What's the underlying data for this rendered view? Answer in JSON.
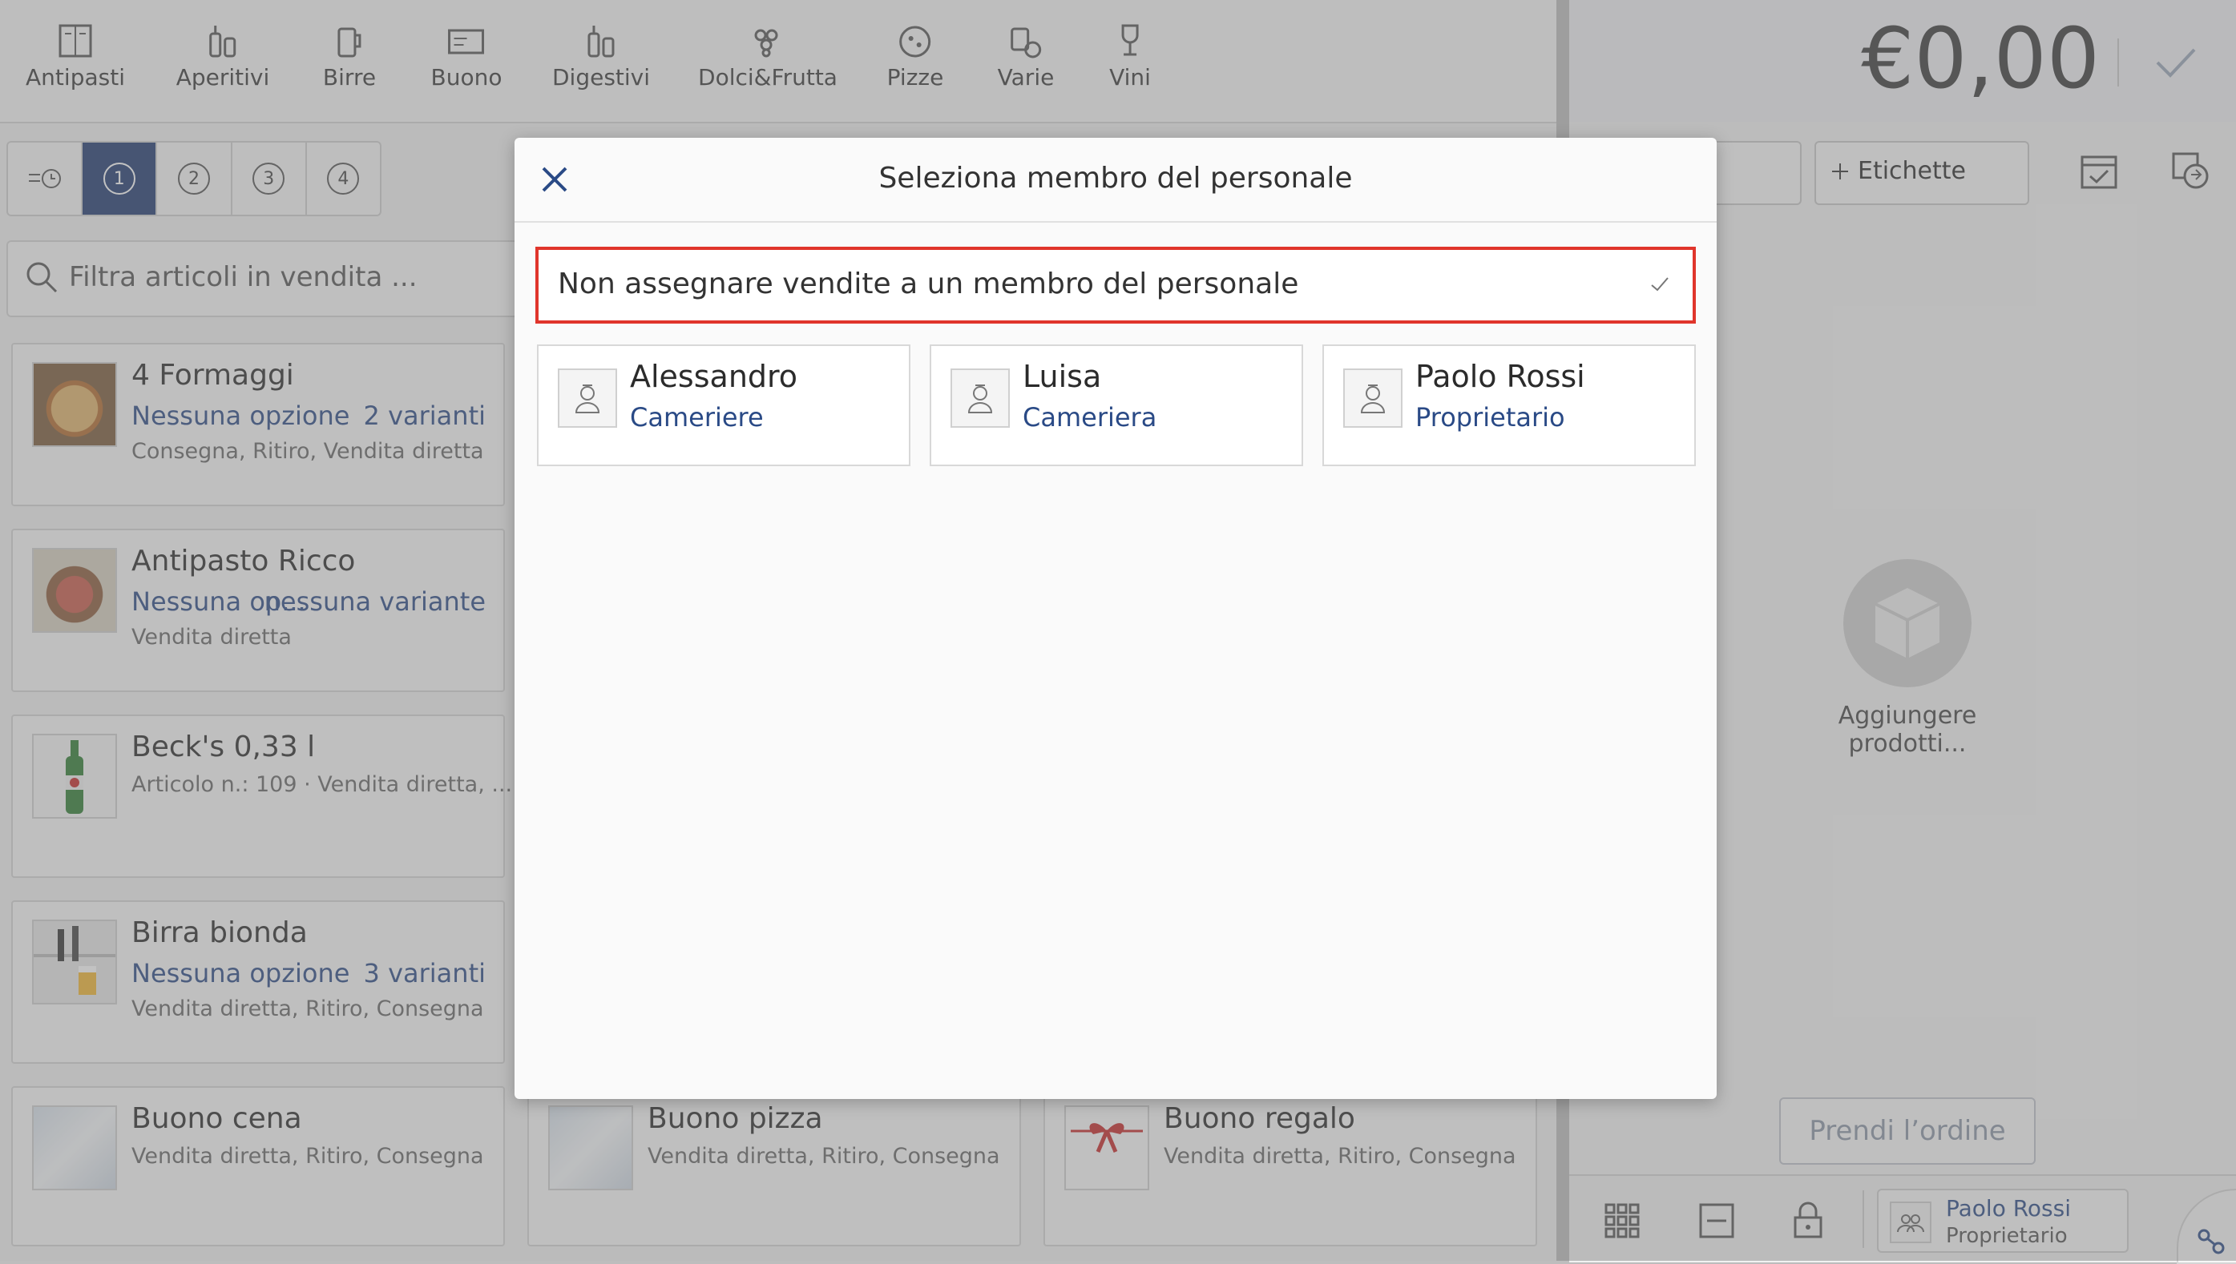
{
  "categories": [
    {
      "label": "Antipasti",
      "icon": "menu-card-icon"
    },
    {
      "label": "Aperitivi",
      "icon": "bottles-icon"
    },
    {
      "label": "Birre",
      "icon": "beer-mug-icon"
    },
    {
      "label": "Buono",
      "icon": "voucher-icon"
    },
    {
      "label": "Digestivi",
      "icon": "bottles-icon"
    },
    {
      "label": "Dolci&Frutta",
      "icon": "grapes-icon"
    },
    {
      "label": "Pizze",
      "icon": "pizza-icon"
    },
    {
      "label": "Varie",
      "icon": "misc-icon"
    },
    {
      "label": "Vini",
      "icon": "wine-glass-icon"
    }
  ],
  "tabs": [
    "1",
    "2",
    "3",
    "4"
  ],
  "filter": {
    "placeholder": "Filtra articoli in vendita ..."
  },
  "products": [
    {
      "title": "4 Formaggi",
      "option": "Nessuna opzione",
      "variants": "2 varianti",
      "meta": "Consegna, Ritiro, Vendita diretta"
    },
    {
      "title": "Antipasto Ricco",
      "option": "Nessuna op...",
      "variants": "nessuna variante",
      "meta": "Vendita diretta"
    },
    {
      "title": "Beck's 0,33 l",
      "option": "",
      "variants": "",
      "meta": "Articolo n.: 109 · Vendita diretta, ..."
    },
    {
      "title": "Birra bionda",
      "option": "Nessuna opzione",
      "variants": "3 varianti",
      "meta": "Vendita diretta, Ritiro, Consegna"
    },
    {
      "title": "Buono cena",
      "option": "",
      "variants": "",
      "meta": "Vendita diretta, Ritiro, Consegna"
    },
    {
      "title": "Buono pizza",
      "option": "",
      "variants": "",
      "meta": "Vendita diretta, Ritiro, Consegna"
    },
    {
      "title": "Buono regalo",
      "option": "",
      "variants": "",
      "meta": "Vendita diretta, Ritiro, Consegna"
    }
  ],
  "order": {
    "amount": "€0,00",
    "labels_button": "Etichette",
    "empty_text": "Aggiungere prodotti...",
    "take_order": "Prendi l’ordine",
    "staff_name": "Paolo Rossi",
    "staff_role": "Proprietario"
  },
  "modal": {
    "title": "Seleziona membro del personale",
    "no_assign": "Non assegnare vendite a un membro del personale",
    "staff": [
      {
        "name": "Alessandro",
        "role": "Cameriere"
      },
      {
        "name": "Luisa",
        "role": "Cameriera"
      },
      {
        "name": "Paolo Rossi",
        "role": "Proprietario"
      }
    ]
  },
  "colors": {
    "accent": "#1f3a70",
    "link": "#2a4a86",
    "highlight": "#e0352b"
  }
}
